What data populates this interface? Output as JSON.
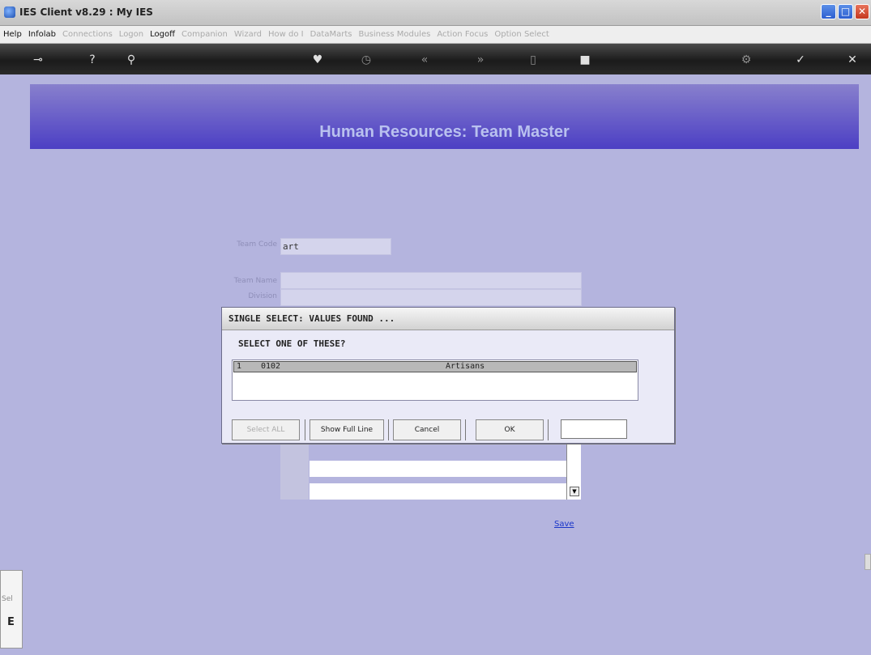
{
  "window": {
    "title": "IES Client v8.29 : My IES"
  },
  "menu": [
    {
      "label": "Help",
      "enabled": true
    },
    {
      "label": "Infolab",
      "enabled": true
    },
    {
      "label": "Connections",
      "enabled": false
    },
    {
      "label": "Logon",
      "enabled": false
    },
    {
      "label": "Logoff",
      "enabled": true
    },
    {
      "label": "Companion",
      "enabled": false
    },
    {
      "label": "Wizard",
      "enabled": false
    },
    {
      "label": "How do I",
      "enabled": false
    },
    {
      "label": "DataMarts",
      "enabled": false
    },
    {
      "label": "Business Modules",
      "enabled": false
    },
    {
      "label": "Action Focus",
      "enabled": false
    },
    {
      "label": "Option Select",
      "enabled": false
    }
  ],
  "toolbar_icons": [
    "key-icon",
    "help-icon",
    "search-icon",
    "heart-icon",
    "clock-icon",
    "rewind-icon",
    "fast-forward-icon",
    "doc-icon",
    "stop-icon",
    "gear-icon",
    "check-icon",
    "close-icon"
  ],
  "page": {
    "title": "Human Resources: Team Master"
  },
  "form": {
    "team_code_label": "Team Code",
    "team_code_value": "art",
    "team_name_label": "Team Name",
    "team_name_value": "",
    "division_label": "Division",
    "division_value": ""
  },
  "dialog": {
    "title": "SINGLE SELECT: VALUES FOUND ...",
    "prompt": "SELECT ONE OF THESE?",
    "rows": [
      {
        "num": "1",
        "code": "0102",
        "name": "Artisans"
      }
    ],
    "buttons": {
      "select_all": "Select ALL",
      "show_full_line": "Show Full Line",
      "cancel": "Cancel",
      "ok": "OK"
    },
    "input_value": ""
  },
  "save_link": "Save",
  "bottom_left": {
    "line1": "Sel",
    "line2": "E"
  },
  "colors": {
    "banner_top": "#8880cd",
    "banner_bottom": "#4c3fc4",
    "background": "#b4b4de"
  }
}
